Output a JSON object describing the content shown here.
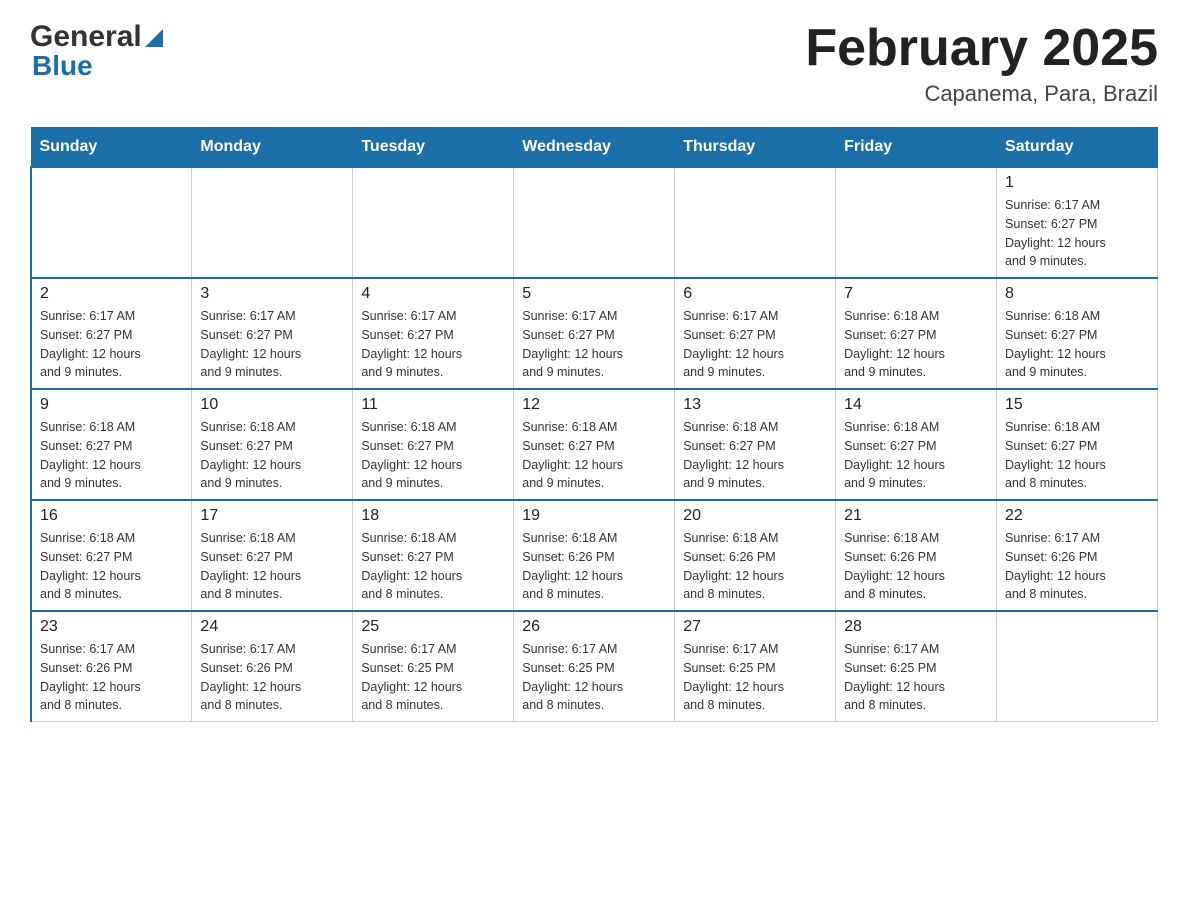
{
  "header": {
    "logo_general": "General",
    "logo_blue": "Blue",
    "month_year": "February 2025",
    "location": "Capanema, Para, Brazil"
  },
  "days_of_week": [
    "Sunday",
    "Monday",
    "Tuesday",
    "Wednesday",
    "Thursday",
    "Friday",
    "Saturday"
  ],
  "weeks": [
    [
      {
        "day": "",
        "info": ""
      },
      {
        "day": "",
        "info": ""
      },
      {
        "day": "",
        "info": ""
      },
      {
        "day": "",
        "info": ""
      },
      {
        "day": "",
        "info": ""
      },
      {
        "day": "",
        "info": ""
      },
      {
        "day": "1",
        "info": "Sunrise: 6:17 AM\nSunset: 6:27 PM\nDaylight: 12 hours\nand 9 minutes."
      }
    ],
    [
      {
        "day": "2",
        "info": "Sunrise: 6:17 AM\nSunset: 6:27 PM\nDaylight: 12 hours\nand 9 minutes."
      },
      {
        "day": "3",
        "info": "Sunrise: 6:17 AM\nSunset: 6:27 PM\nDaylight: 12 hours\nand 9 minutes."
      },
      {
        "day": "4",
        "info": "Sunrise: 6:17 AM\nSunset: 6:27 PM\nDaylight: 12 hours\nand 9 minutes."
      },
      {
        "day": "5",
        "info": "Sunrise: 6:17 AM\nSunset: 6:27 PM\nDaylight: 12 hours\nand 9 minutes."
      },
      {
        "day": "6",
        "info": "Sunrise: 6:17 AM\nSunset: 6:27 PM\nDaylight: 12 hours\nand 9 minutes."
      },
      {
        "day": "7",
        "info": "Sunrise: 6:18 AM\nSunset: 6:27 PM\nDaylight: 12 hours\nand 9 minutes."
      },
      {
        "day": "8",
        "info": "Sunrise: 6:18 AM\nSunset: 6:27 PM\nDaylight: 12 hours\nand 9 minutes."
      }
    ],
    [
      {
        "day": "9",
        "info": "Sunrise: 6:18 AM\nSunset: 6:27 PM\nDaylight: 12 hours\nand 9 minutes."
      },
      {
        "day": "10",
        "info": "Sunrise: 6:18 AM\nSunset: 6:27 PM\nDaylight: 12 hours\nand 9 minutes."
      },
      {
        "day": "11",
        "info": "Sunrise: 6:18 AM\nSunset: 6:27 PM\nDaylight: 12 hours\nand 9 minutes."
      },
      {
        "day": "12",
        "info": "Sunrise: 6:18 AM\nSunset: 6:27 PM\nDaylight: 12 hours\nand 9 minutes."
      },
      {
        "day": "13",
        "info": "Sunrise: 6:18 AM\nSunset: 6:27 PM\nDaylight: 12 hours\nand 9 minutes."
      },
      {
        "day": "14",
        "info": "Sunrise: 6:18 AM\nSunset: 6:27 PM\nDaylight: 12 hours\nand 9 minutes."
      },
      {
        "day": "15",
        "info": "Sunrise: 6:18 AM\nSunset: 6:27 PM\nDaylight: 12 hours\nand 8 minutes."
      }
    ],
    [
      {
        "day": "16",
        "info": "Sunrise: 6:18 AM\nSunset: 6:27 PM\nDaylight: 12 hours\nand 8 minutes."
      },
      {
        "day": "17",
        "info": "Sunrise: 6:18 AM\nSunset: 6:27 PM\nDaylight: 12 hours\nand 8 minutes."
      },
      {
        "day": "18",
        "info": "Sunrise: 6:18 AM\nSunset: 6:27 PM\nDaylight: 12 hours\nand 8 minutes."
      },
      {
        "day": "19",
        "info": "Sunrise: 6:18 AM\nSunset: 6:26 PM\nDaylight: 12 hours\nand 8 minutes."
      },
      {
        "day": "20",
        "info": "Sunrise: 6:18 AM\nSunset: 6:26 PM\nDaylight: 12 hours\nand 8 minutes."
      },
      {
        "day": "21",
        "info": "Sunrise: 6:18 AM\nSunset: 6:26 PM\nDaylight: 12 hours\nand 8 minutes."
      },
      {
        "day": "22",
        "info": "Sunrise: 6:17 AM\nSunset: 6:26 PM\nDaylight: 12 hours\nand 8 minutes."
      }
    ],
    [
      {
        "day": "23",
        "info": "Sunrise: 6:17 AM\nSunset: 6:26 PM\nDaylight: 12 hours\nand 8 minutes."
      },
      {
        "day": "24",
        "info": "Sunrise: 6:17 AM\nSunset: 6:26 PM\nDaylight: 12 hours\nand 8 minutes."
      },
      {
        "day": "25",
        "info": "Sunrise: 6:17 AM\nSunset: 6:25 PM\nDaylight: 12 hours\nand 8 minutes."
      },
      {
        "day": "26",
        "info": "Sunrise: 6:17 AM\nSunset: 6:25 PM\nDaylight: 12 hours\nand 8 minutes."
      },
      {
        "day": "27",
        "info": "Sunrise: 6:17 AM\nSunset: 6:25 PM\nDaylight: 12 hours\nand 8 minutes."
      },
      {
        "day": "28",
        "info": "Sunrise: 6:17 AM\nSunset: 6:25 PM\nDaylight: 12 hours\nand 8 minutes."
      },
      {
        "day": "",
        "info": ""
      }
    ]
  ]
}
